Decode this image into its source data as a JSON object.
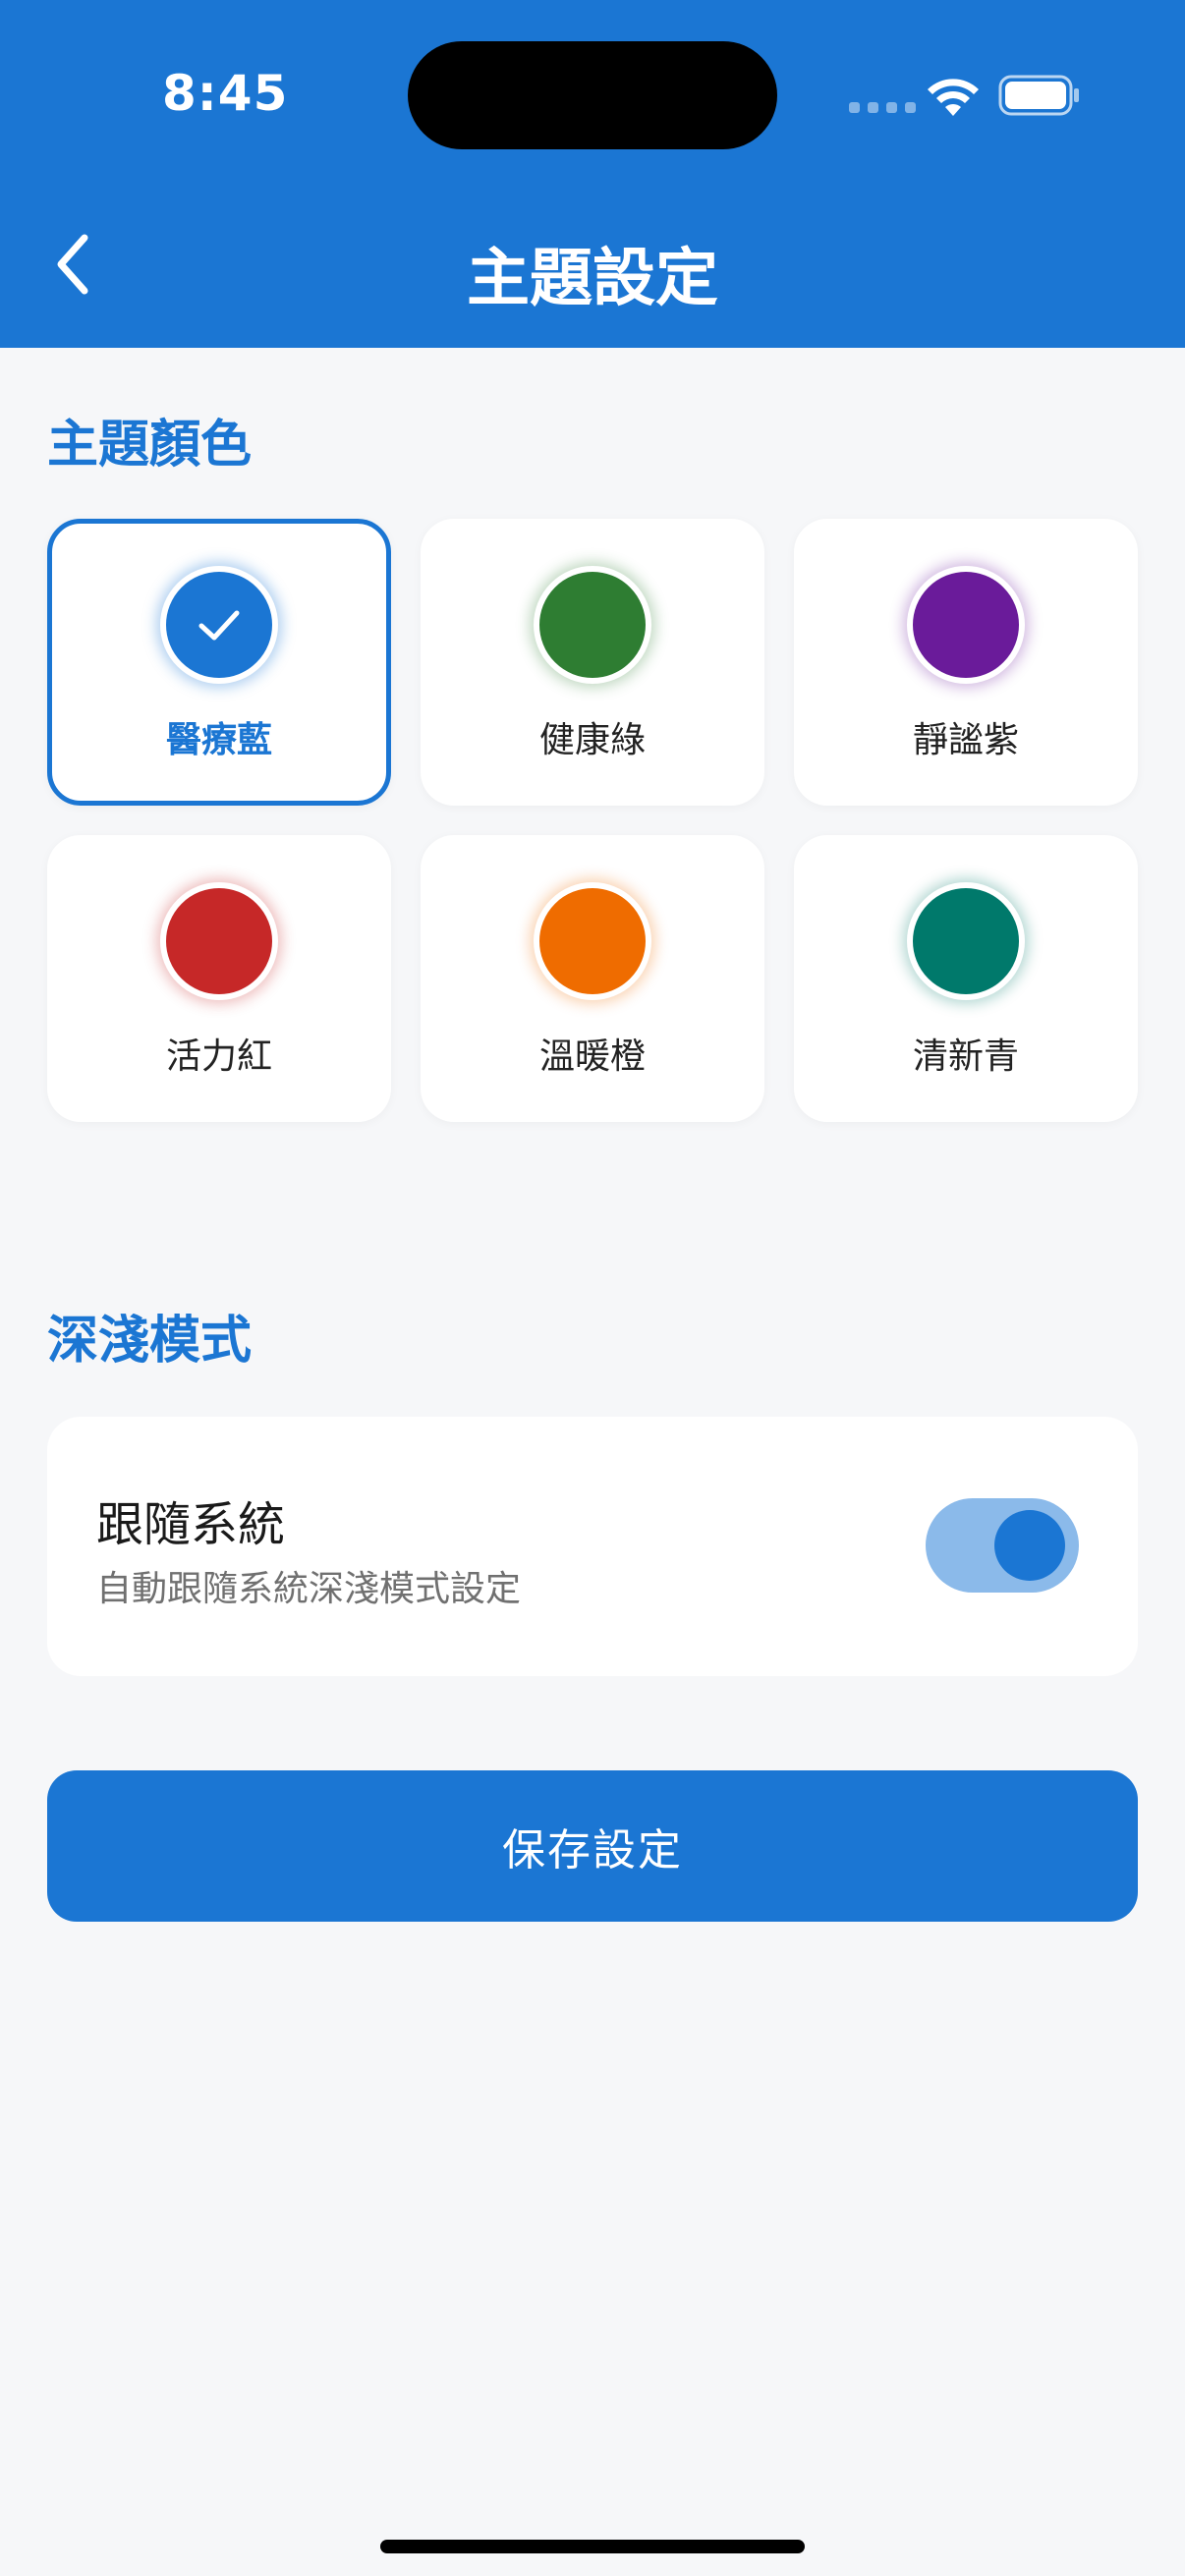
{
  "status_bar": {
    "time": "8:45"
  },
  "header": {
    "title": "主題設定",
    "back_icon": "chevron-left-icon"
  },
  "theme_section": {
    "title": "主題顏色",
    "selected_index": 0,
    "colors": [
      {
        "label": "醫療藍",
        "color": "#1b76d3",
        "glow": "rgba(27,118,211,0.35)",
        "selected": true
      },
      {
        "label": "健康綠",
        "color": "#2e7d32",
        "glow": "rgba(46,125,50,0.30)",
        "selected": false
      },
      {
        "label": "靜謐紫",
        "color": "#6a1b9a",
        "glow": "rgba(106,27,154,0.30)",
        "selected": false
      },
      {
        "label": "活力紅",
        "color": "#c62828",
        "glow": "rgba(198,40,40,0.30)",
        "selected": false
      },
      {
        "label": "溫暖橙",
        "color": "#ef6c00",
        "glow": "rgba(239,108,0,0.30)",
        "selected": false
      },
      {
        "label": "清新青",
        "color": "#00796b",
        "glow": "rgba(0,121,107,0.30)",
        "selected": false
      }
    ]
  },
  "mode_section": {
    "title": "深淺模式",
    "option_title": "跟隨系統",
    "option_desc": "自動跟隨系統深淺模式設定",
    "toggle_on": true
  },
  "save_button": {
    "label": "保存設定"
  },
  "colors": {
    "primary": "#1b76d3",
    "background": "#f6f7f9"
  }
}
